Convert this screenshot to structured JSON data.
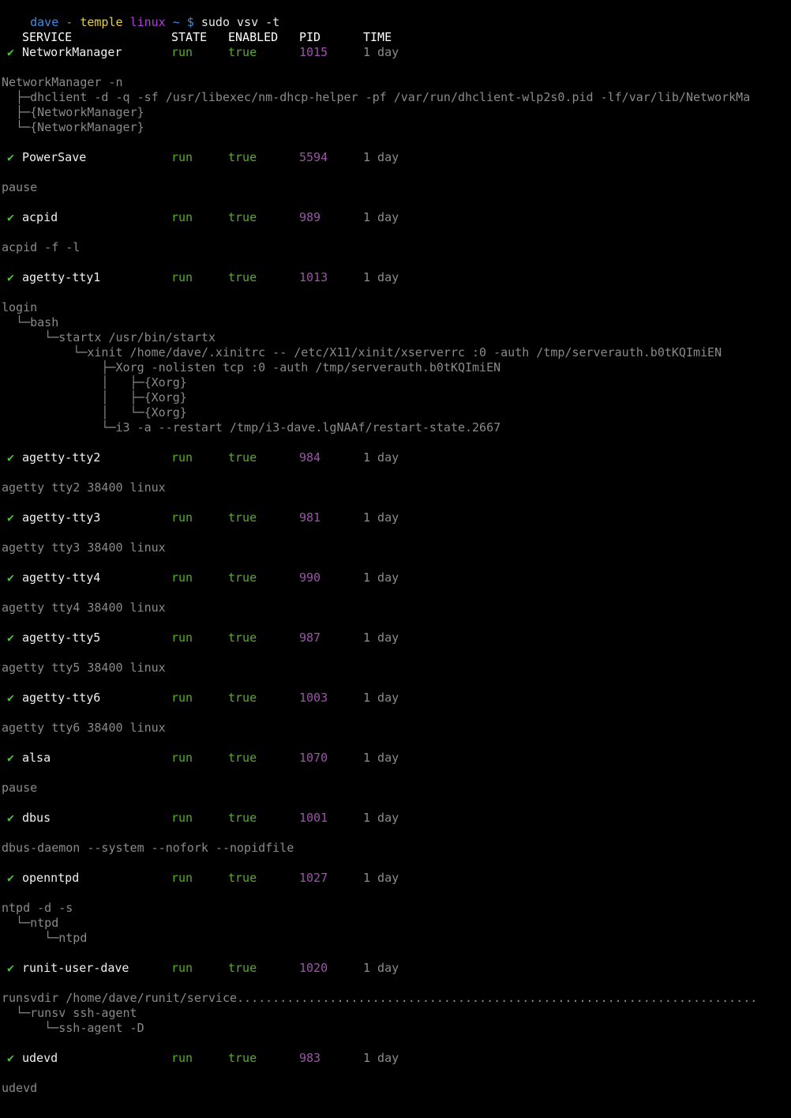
{
  "prompt": {
    "user": "dave",
    "sep1": " - ",
    "host": "temple",
    "distro": "linux",
    "path_symbol": "~ $",
    "command": "sudo vsv -t"
  },
  "table_header": {
    "service": "SERVICE",
    "state": "STATE",
    "enabled": "ENABLED",
    "pid": "PID",
    "time": "TIME"
  },
  "services": [
    {
      "check": "✔",
      "name": "NetworkManager",
      "state": "run",
      "enabled": "true",
      "pid": "1015",
      "time": "1 day",
      "tree": [
        "NetworkManager -n",
        "  ├─dhclient -d -q -sf /usr/libexec/nm-dhcp-helper -pf /var/run/dhclient-wlp2s0.pid -lf/var/lib/NetworkMa",
        "  ├─{NetworkManager}",
        "  └─{NetworkManager}"
      ]
    },
    {
      "check": "✔",
      "name": "PowerSave",
      "state": "run",
      "enabled": "true",
      "pid": "5594",
      "time": "1 day",
      "tree": [
        "pause"
      ]
    },
    {
      "check": "✔",
      "name": "acpid",
      "state": "run",
      "enabled": "true",
      "pid": "989",
      "time": "1 day",
      "tree": [
        "acpid -f -l"
      ]
    },
    {
      "check": "✔",
      "name": "agetty-tty1",
      "state": "run",
      "enabled": "true",
      "pid": "1013",
      "time": "1 day",
      "tree": [
        "login",
        "  └─bash",
        "      └─startx /usr/bin/startx",
        "          └─xinit /home/dave/.xinitrc -- /etc/X11/xinit/xserverrc :0 -auth /tmp/serverauth.b0tKQImiEN",
        "              ├─Xorg -nolisten tcp :0 -auth /tmp/serverauth.b0tKQImiEN",
        "              │   ├─{Xorg}",
        "              │   ├─{Xorg}",
        "              │   └─{Xorg}",
        "              └─i3 -a --restart /tmp/i3-dave.lgNAAf/restart-state.2667"
      ]
    },
    {
      "check": "✔",
      "name": "agetty-tty2",
      "state": "run",
      "enabled": "true",
      "pid": "984",
      "time": "1 day",
      "tree": [
        "agetty tty2 38400 linux"
      ]
    },
    {
      "check": "✔",
      "name": "agetty-tty3",
      "state": "run",
      "enabled": "true",
      "pid": "981",
      "time": "1 day",
      "tree": [
        "agetty tty3 38400 linux"
      ]
    },
    {
      "check": "✔",
      "name": "agetty-tty4",
      "state": "run",
      "enabled": "true",
      "pid": "990",
      "time": "1 day",
      "tree": [
        "agetty tty4 38400 linux"
      ]
    },
    {
      "check": "✔",
      "name": "agetty-tty5",
      "state": "run",
      "enabled": "true",
      "pid": "987",
      "time": "1 day",
      "tree": [
        "agetty tty5 38400 linux"
      ]
    },
    {
      "check": "✔",
      "name": "agetty-tty6",
      "state": "run",
      "enabled": "true",
      "pid": "1003",
      "time": "1 day",
      "tree": [
        "agetty tty6 38400 linux"
      ]
    },
    {
      "check": "✔",
      "name": "alsa",
      "state": "run",
      "enabled": "true",
      "pid": "1070",
      "time": "1 day",
      "tree": [
        "pause"
      ]
    },
    {
      "check": "✔",
      "name": "dbus",
      "state": "run",
      "enabled": "true",
      "pid": "1001",
      "time": "1 day",
      "tree": [
        "dbus-daemon --system --nofork --nopidfile"
      ]
    },
    {
      "check": "✔",
      "name": "openntpd",
      "state": "run",
      "enabled": "true",
      "pid": "1027",
      "time": "1 day",
      "tree": [
        "ntpd -d -s",
        "  └─ntpd",
        "      └─ntpd"
      ]
    },
    {
      "check": "✔",
      "name": "runit-user-dave",
      "state": "run",
      "enabled": "true",
      "pid": "1020",
      "time": "1 day",
      "tree": [
        "runsvdir /home/dave/runit/service.........................................................................",
        "  └─runsv ssh-agent",
        "      └─ssh-agent -D"
      ]
    },
    {
      "check": "✔",
      "name": "udevd",
      "state": "run",
      "enabled": "true",
      "pid": "983",
      "time": "1 day",
      "tree": [
        "udevd"
      ]
    }
  ]
}
